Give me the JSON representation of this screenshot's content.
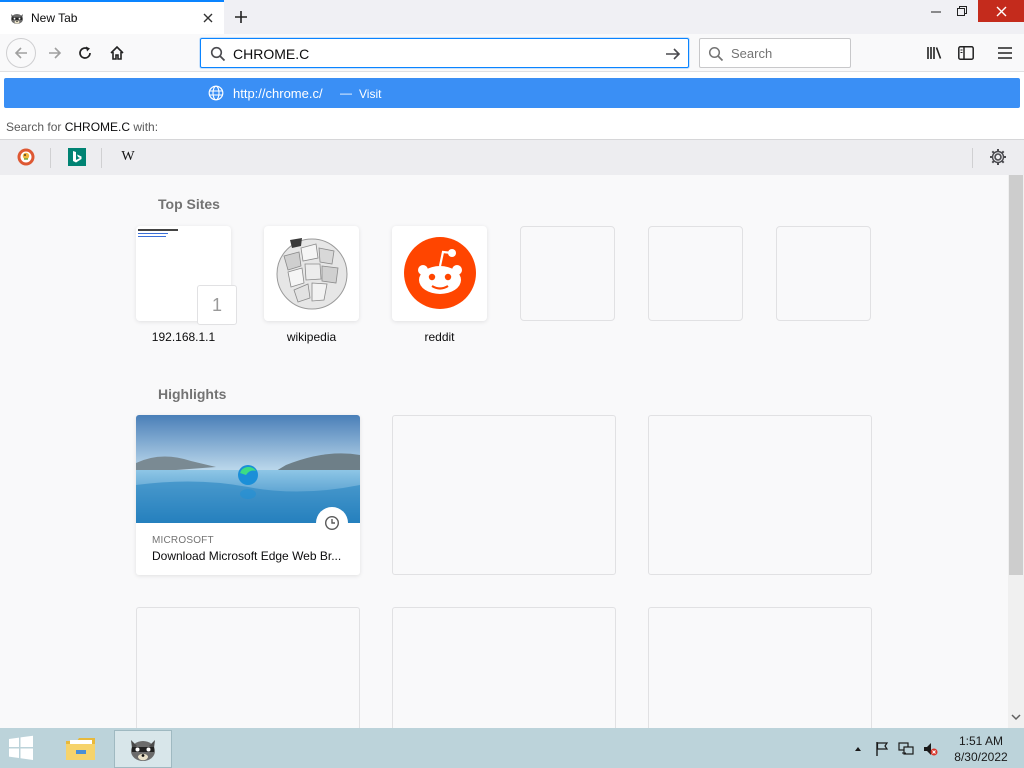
{
  "browser": {
    "tab": {
      "title": "New Tab",
      "favicon": "raccoon-icon"
    },
    "window_controls": [
      "minimize",
      "maximize",
      "close"
    ],
    "urlbar": {
      "value": "CHROME.C"
    },
    "searchbar": {
      "placeholder": "Search"
    },
    "accent_color": "#0a84ff"
  },
  "dropdown": {
    "suggestion": {
      "url": "http://chrome.c/",
      "separator": "—",
      "action": "Visit",
      "highlight_color": "#3a8ff5"
    },
    "search_for": {
      "prefix": "Search for",
      "query": "CHROME.C",
      "suffix": "with:"
    },
    "engines": [
      {
        "name": "DuckDuckGo",
        "icon": "duckduckgo-icon"
      },
      {
        "name": "Bing",
        "icon": "bing-icon"
      },
      {
        "name": "Wikipedia",
        "icon": "wikipedia-icon",
        "glyph": "W"
      }
    ]
  },
  "newtab": {
    "top_sites_title": "Top Sites",
    "top_sites": [
      {
        "label": "192.168.1.1",
        "pinned_badge": "1"
      },
      {
        "label": "wikipedia"
      },
      {
        "label": "reddit"
      },
      {
        "label": ""
      },
      {
        "label": ""
      },
      {
        "label": ""
      }
    ],
    "highlights_title": "Highlights",
    "highlights": [
      {
        "source": "MICROSOFT",
        "title": "Download Microsoft Edge Web Br..."
      }
    ]
  },
  "taskbar": {
    "time": "1:51 AM",
    "date": "8/30/2022"
  }
}
